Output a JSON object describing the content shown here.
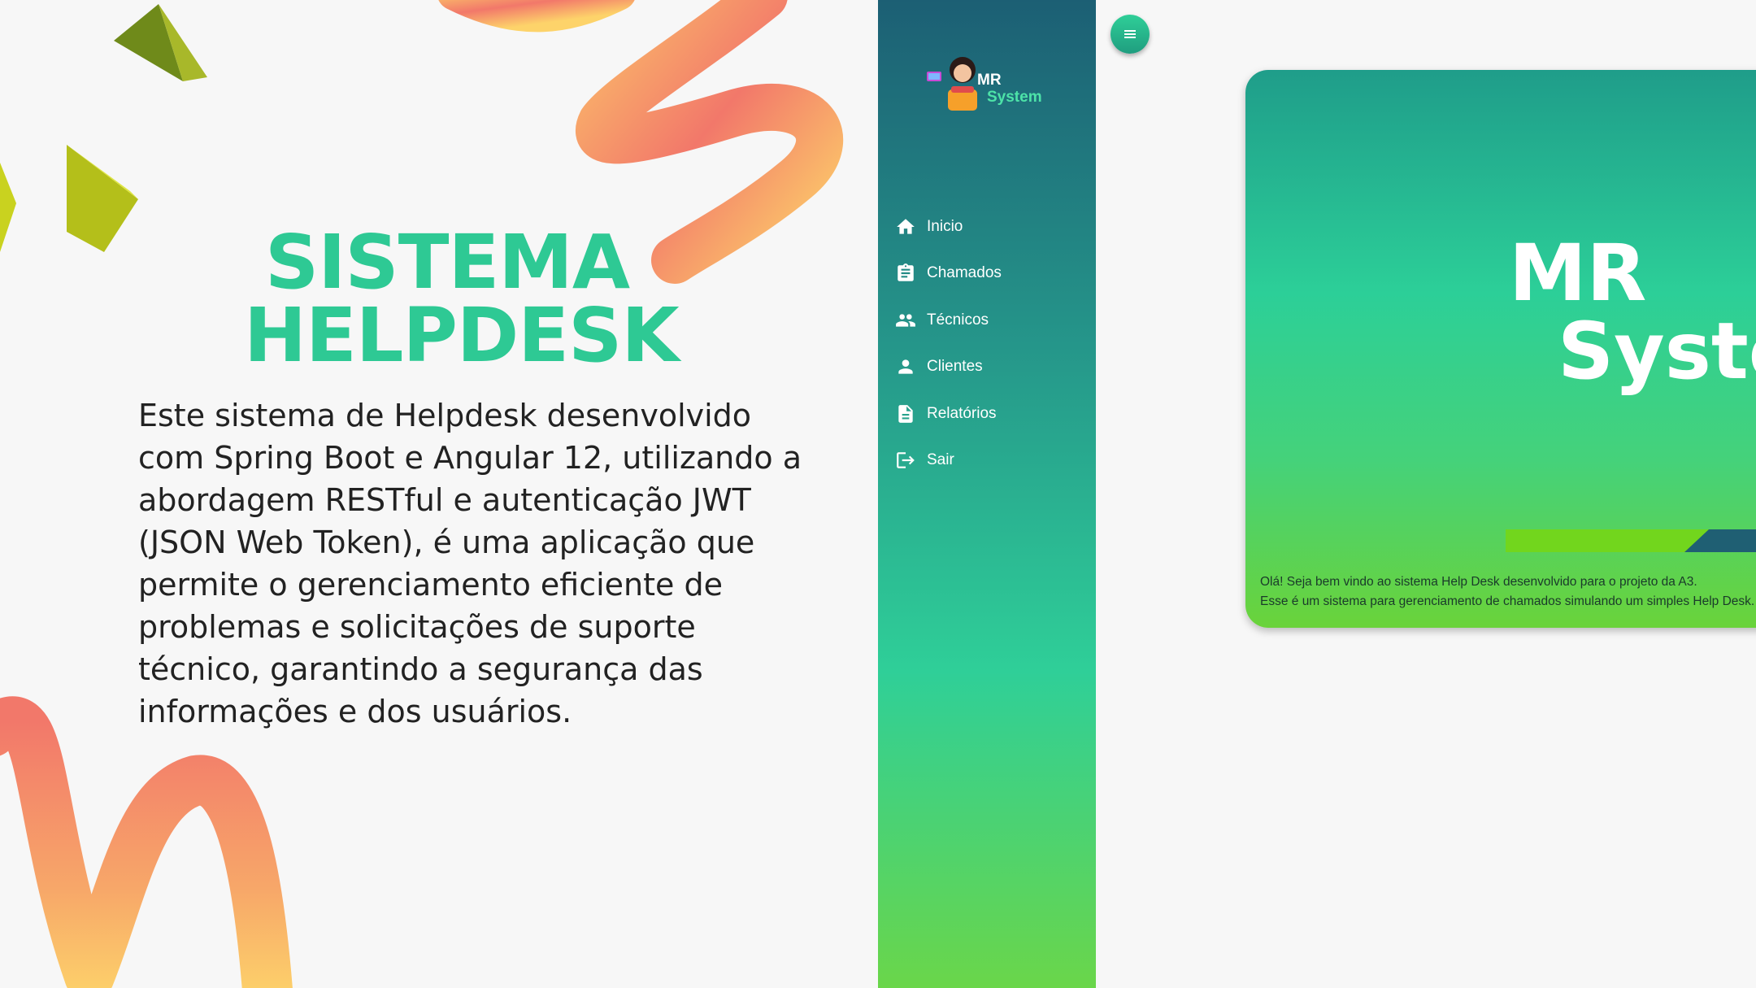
{
  "promo": {
    "title_line1": "SISTEMA",
    "title_line2": "HELPDESK",
    "description": "Este sistema de Helpdesk desenvolvido com Spring Boot e Angular 12, utilizando a abordagem RESTful e autenticação JWT (JSON Web Token), é uma aplicação que permite o gerenciamento eficiente de problemas e solicitações de suporte técnico, garantindo a segurança das informações e dos usuários."
  },
  "logo": {
    "line1": "MR",
    "line2": "System"
  },
  "nav": {
    "items": [
      {
        "label": "Inicio",
        "icon": "home-icon"
      },
      {
        "label": "Chamados",
        "icon": "clipboard-icon"
      },
      {
        "label": "Técnicos",
        "icon": "group-icon"
      },
      {
        "label": "Clientes",
        "icon": "person-icon"
      },
      {
        "label": "Relatórios",
        "icon": "document-icon"
      },
      {
        "label": "Sair",
        "icon": "logout-icon"
      }
    ]
  },
  "menu_button": {
    "icon": "hamburger-icon"
  },
  "hero": {
    "title_line1": "MR",
    "title_line2": "System",
    "welcome_line1": "Olá! Seja bem vindo ao sistema Help Desk desenvolvido para o projeto da A3.",
    "welcome_line2": "Esse é um sistema para gerenciamento de chamados simulando um simples Help Desk."
  },
  "colors": {
    "accent_green": "#2ec994",
    "sidebar_top": "#1c5f74",
    "sidebar_bottom": "#6ad64a"
  }
}
